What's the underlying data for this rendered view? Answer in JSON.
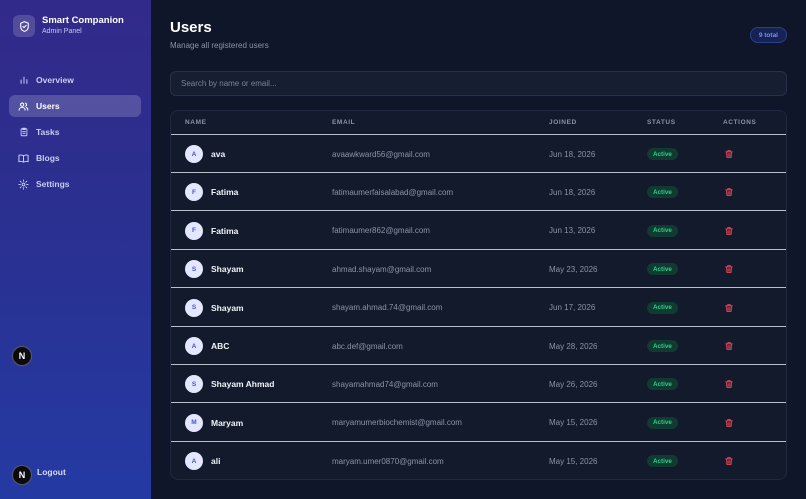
{
  "brand": {
    "title": "Smart Companion",
    "subtitle": "Admin Panel"
  },
  "sidebar": {
    "items": [
      {
        "label": "Overview",
        "icon": "bar-chart-icon",
        "active": false
      },
      {
        "label": "Users",
        "icon": "users-icon",
        "active": true
      },
      {
        "label": "Tasks",
        "icon": "clipboard-icon",
        "active": false
      },
      {
        "label": "Blogs",
        "icon": "book-icon",
        "active": false
      },
      {
        "label": "Settings",
        "icon": "gear-icon",
        "active": false
      }
    ],
    "badge_letter": "N",
    "logout_label": "Logout"
  },
  "header": {
    "title": "Users",
    "subtitle": "Manage all registered users",
    "total_badge": "9 total"
  },
  "search": {
    "placeholder": "Search by name or email..."
  },
  "table": {
    "columns": [
      "NAME",
      "EMAIL",
      "JOINED",
      "STATUS",
      "ACTIONS"
    ],
    "rows": [
      {
        "initial": "A",
        "name": "ava",
        "email": "avaawkward56@gmail.com",
        "joined": "Jun 18, 2026",
        "status": "Active"
      },
      {
        "initial": "F",
        "name": "Fatima",
        "email": "fatimaumerfaisalabad@gmail.com",
        "joined": "Jun 18, 2026",
        "status": "Active"
      },
      {
        "initial": "F",
        "name": "Fatima",
        "email": "fatimaumer862@gmail.com",
        "joined": "Jun 13, 2026",
        "status": "Active"
      },
      {
        "initial": "S",
        "name": "Shayam",
        "email": "ahmad.shayam@gmail.com",
        "joined": "May 23, 2026",
        "status": "Active"
      },
      {
        "initial": "S",
        "name": "Shayam",
        "email": "shayam.ahmad.74@gmail.com",
        "joined": "Jun 17, 2026",
        "status": "Active"
      },
      {
        "initial": "A",
        "name": "ABC",
        "email": "abc.def@gmail.com",
        "joined": "May 28, 2026",
        "status": "Active"
      },
      {
        "initial": "S",
        "name": "Shayam Ahmad",
        "email": "shayamahmad74@gmail.com",
        "joined": "May 26, 2026",
        "status": "Active"
      },
      {
        "initial": "M",
        "name": "Maryam",
        "email": "maryamumerbiochemist@gmail.com",
        "joined": "May 15, 2026",
        "status": "Active"
      },
      {
        "initial": "A",
        "name": "ali",
        "email": "maryam.umer0870@gmail.com",
        "joined": "May 15, 2026",
        "status": "Active"
      }
    ]
  },
  "colors": {
    "accent": "#7c8cff",
    "status_active": "#2ecf8a",
    "delete": "#e2455a"
  }
}
